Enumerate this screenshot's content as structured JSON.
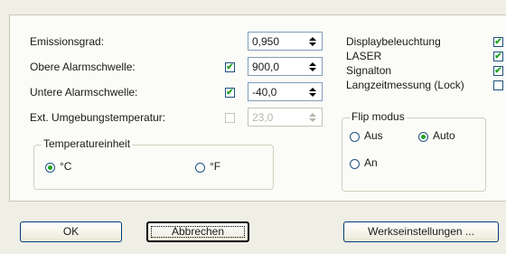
{
  "left": {
    "emissionsgrad_label": "Emissionsgrad:",
    "emissionsgrad_value": "0,950",
    "obere_label": "Obere Alarmschwelle:",
    "obere_value": "900,0",
    "obere_checked": true,
    "untere_label": "Untere Alarmschwelle:",
    "untere_value": "-40,0",
    "untere_checked": true,
    "ext_label": "Ext. Umgebungstemperatur:",
    "ext_value": "23,0",
    "ext_checked": false
  },
  "temperatureinheit": {
    "title": "Temperatureinheit",
    "options": [
      {
        "label": "°C",
        "selected": true
      },
      {
        "label": "°F",
        "selected": false
      }
    ]
  },
  "right": {
    "displaybeleuchtung_label": "Displaybeleuchtung",
    "laser_label": "LASER",
    "signalton_label": "Signalton",
    "langzeit_label": "Langzeitmessung (Lock)"
  },
  "flip": {
    "title": "Flip modus",
    "options": [
      {
        "label": "Aus",
        "selected": false
      },
      {
        "label": "Auto",
        "selected": true
      },
      {
        "label": "An",
        "selected": false
      }
    ]
  },
  "buttons": {
    "ok": "OK",
    "abbrechen": "Abbrechen",
    "werkseinstellungen": "Werkseinstellungen ..."
  },
  "colors": {
    "background": "#f0efe6",
    "panel": "#fbfbf8",
    "checkmark": "#21a121",
    "border_blue": "#1c5180"
  }
}
